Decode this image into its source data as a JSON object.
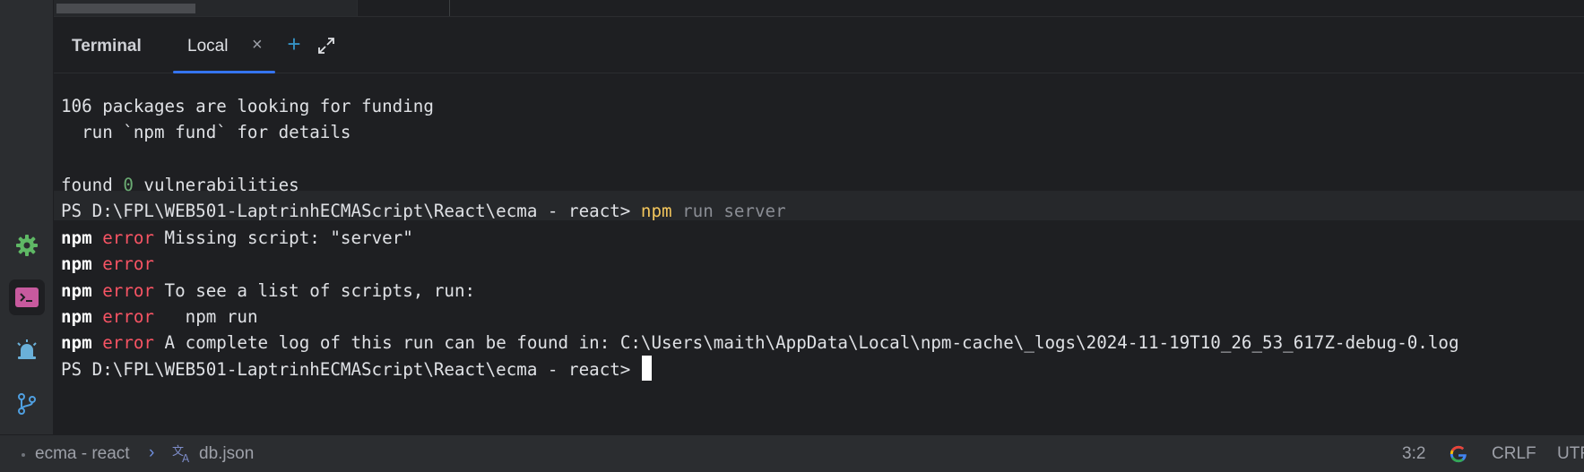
{
  "left_toolbar": {
    "items": [
      {
        "name": "services",
        "icon": "gear-icon",
        "color": "#5fb865"
      },
      {
        "name": "terminal",
        "icon": "terminal-icon",
        "color": "#c75a9e",
        "active": true
      },
      {
        "name": "problems",
        "icon": "alarm-icon",
        "color": "#6ab0d9"
      },
      {
        "name": "git",
        "icon": "git-branch-icon",
        "color": "#4f9fe0"
      }
    ]
  },
  "panel": {
    "title": "Terminal",
    "tabs": [
      {
        "label": "Local",
        "close": "×",
        "active": true
      }
    ],
    "new_tab": "+",
    "maximize_icon": "expand-icon"
  },
  "terminal": {
    "funding_line": "106 packages are looking for funding",
    "fund_hint": "  run `npm fund` for details",
    "found_prefix": "found ",
    "found_count": "0",
    "found_suffix": " vulnerabilities",
    "prompt": "PS D:\\FPL\\WEB501-LaptrinhECMAScript\\React\\ecma - react> ",
    "command": "npm",
    "command_args": " run server",
    "npm_label": "npm",
    "error_label": "error",
    "errors": [
      " Missing script: \"server\"",
      "",
      " To see a list of scripts, run:",
      "   npm run",
      " A complete log of this run can be found in: C:\\Users\\maith\\AppData\\Local\\npm-cache\\_logs\\2024-11-19T10_26_53_617Z-debug-0.log"
    ],
    "final_prompt": "PS D:\\FPL\\WEB501-LaptrinhECMAScript\\React\\ecma - react> "
  },
  "status_bar": {
    "project": "ecma - react",
    "chevron": "›",
    "file": "db.json",
    "file_icon": "translate-icon",
    "position": "3:2",
    "google_icon": "google-icon",
    "line_ending": "CRLF",
    "encoding": "UTF"
  }
}
